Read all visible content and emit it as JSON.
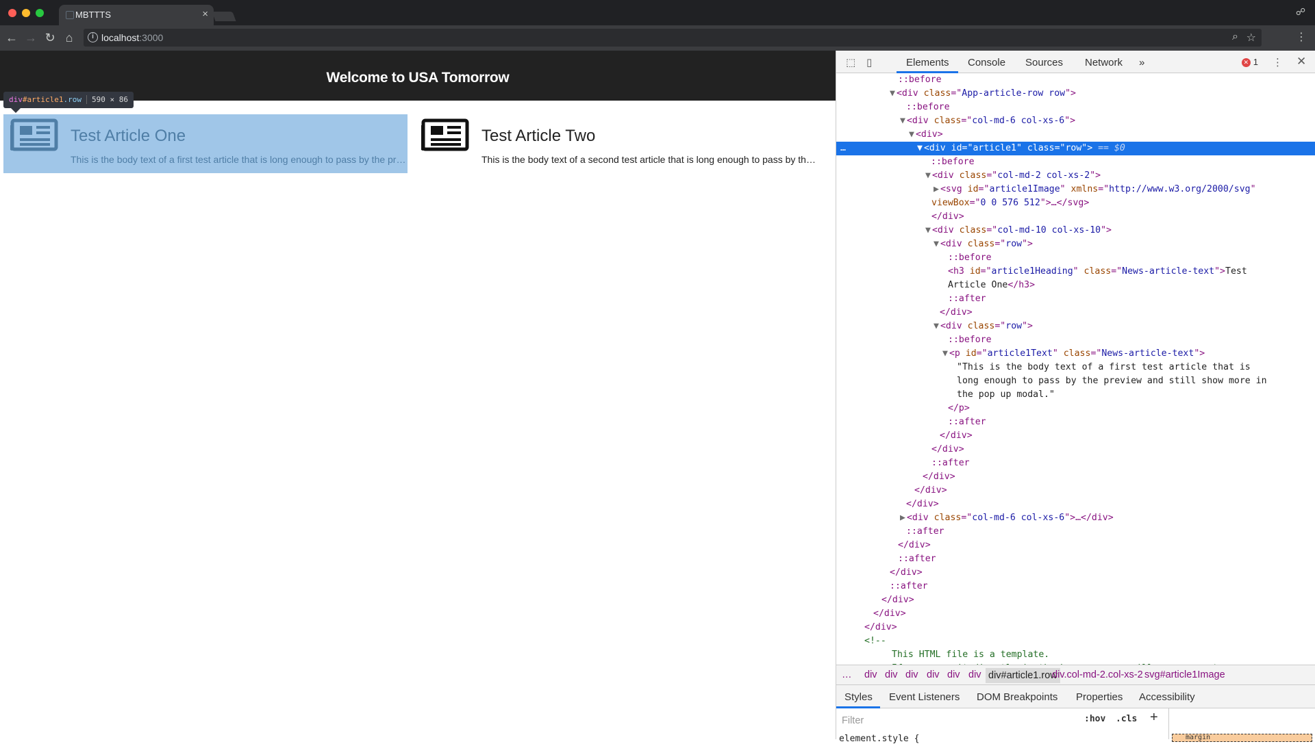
{
  "browser": {
    "tab_title": "MBTTTS",
    "url_host": "localhost",
    "url_port": ":3000",
    "traffic_colors": [
      "#fe5f57",
      "#febc2e",
      "#28c840"
    ]
  },
  "page": {
    "title": "Welcome to USA Tomorrow",
    "articles": [
      {
        "heading": "Test Article One",
        "text": "This is the body text of a first test article that is long enough to pass by the preview and still show more in the pop up modal."
      },
      {
        "heading": "Test Article Two",
        "text": "This is the body text of a second test article that is long enough to pass by the preview and still show more in the pop up modal."
      }
    ],
    "inspect_tooltip": {
      "tag": "div",
      "id": "#article1",
      "cls": ".row",
      "dims": "590 × 86"
    }
  },
  "devtools": {
    "tabs": [
      "Elements",
      "Console",
      "Sources",
      "Network",
      "»"
    ],
    "error_count": "1",
    "dom_lines": [
      [
        {
          "c": "p",
          "t": "::before"
        }
      ],
      [
        {
          "c": "caret",
          "t": "▼"
        },
        {
          "c": "t",
          "t": "<div "
        },
        {
          "c": "a",
          "t": "class"
        },
        {
          "c": "t",
          "t": "=\""
        },
        {
          "c": "v",
          "t": "App-article-row row"
        },
        {
          "c": "t",
          "t": "\">"
        }
      ],
      [
        {
          "c": "p",
          "t": "::before"
        }
      ],
      [
        {
          "c": "caret",
          "t": "▼"
        },
        {
          "c": "t",
          "t": "<div "
        },
        {
          "c": "a",
          "t": "class"
        },
        {
          "c": "t",
          "t": "=\""
        },
        {
          "c": "v",
          "t": "col-md-6 col-xs-6"
        },
        {
          "c": "t",
          "t": "\">"
        }
      ],
      [
        {
          "c": "caret",
          "t": "▼"
        },
        {
          "c": "t",
          "t": "<div>"
        }
      ],
      [
        {
          "c": "caret",
          "t": "▼"
        },
        {
          "c": "t",
          "t": "<div "
        },
        {
          "c": "a",
          "t": "id"
        },
        {
          "c": "t",
          "t": "=\""
        },
        {
          "c": "v",
          "t": "article1"
        },
        {
          "c": "t",
          "t": "\" "
        },
        {
          "c": "a",
          "t": "class"
        },
        {
          "c": "t",
          "t": "=\""
        },
        {
          "c": "v",
          "t": "row"
        },
        {
          "c": "t",
          "t": "\">"
        },
        {
          "c": "eq0",
          "t": " == $0"
        }
      ],
      [
        {
          "c": "p",
          "t": "::before"
        }
      ],
      [
        {
          "c": "caret",
          "t": "▼"
        },
        {
          "c": "t",
          "t": "<div "
        },
        {
          "c": "a",
          "t": "class"
        },
        {
          "c": "t",
          "t": "=\""
        },
        {
          "c": "v",
          "t": "col-md-2 col-xs-2"
        },
        {
          "c": "t",
          "t": "\">"
        }
      ],
      [
        {
          "c": "caret",
          "t": "▶"
        },
        {
          "c": "t",
          "t": "<svg "
        },
        {
          "c": "a",
          "t": "id"
        },
        {
          "c": "t",
          "t": "=\""
        },
        {
          "c": "v",
          "t": "article1Image"
        },
        {
          "c": "t",
          "t": "\" "
        },
        {
          "c": "a",
          "t": "xmlns"
        },
        {
          "c": "t",
          "t": "=\""
        },
        {
          "c": "v",
          "t": "http://www.w3.org/2000/svg"
        },
        {
          "c": "t",
          "t": "\""
        }
      ],
      [
        {
          "c": "a",
          "t": "viewBox"
        },
        {
          "c": "t",
          "t": "=\""
        },
        {
          "c": "v",
          "t": "0 0 576 512"
        },
        {
          "c": "t",
          "t": "\">…</svg>"
        }
      ],
      [
        {
          "c": "t",
          "t": "</div>"
        }
      ],
      [
        {
          "c": "caret",
          "t": "▼"
        },
        {
          "c": "t",
          "t": "<div "
        },
        {
          "c": "a",
          "t": "class"
        },
        {
          "c": "t",
          "t": "=\""
        },
        {
          "c": "v",
          "t": "col-md-10 col-xs-10"
        },
        {
          "c": "t",
          "t": "\">"
        }
      ],
      [
        {
          "c": "caret",
          "t": "▼"
        },
        {
          "c": "t",
          "t": "<div "
        },
        {
          "c": "a",
          "t": "class"
        },
        {
          "c": "t",
          "t": "=\""
        },
        {
          "c": "v",
          "t": "row"
        },
        {
          "c": "t",
          "t": "\">"
        }
      ],
      [
        {
          "c": "p",
          "t": "::before"
        }
      ],
      [
        {
          "c": "t",
          "t": "<h3 "
        },
        {
          "c": "a",
          "t": "id"
        },
        {
          "c": "t",
          "t": "=\""
        },
        {
          "c": "v",
          "t": "article1Heading"
        },
        {
          "c": "t",
          "t": "\" "
        },
        {
          "c": "a",
          "t": "class"
        },
        {
          "c": "t",
          "t": "=\""
        },
        {
          "c": "v",
          "t": "News-article-text"
        },
        {
          "c": "t",
          "t": "\">"
        },
        {
          "c": "s",
          "t": "Test"
        }
      ],
      [
        {
          "c": "s",
          "t": "Article One"
        },
        {
          "c": "t",
          "t": "</h3>"
        }
      ],
      [
        {
          "c": "p",
          "t": "::after"
        }
      ],
      [
        {
          "c": "t",
          "t": "</div>"
        }
      ],
      [
        {
          "c": "caret",
          "t": "▼"
        },
        {
          "c": "t",
          "t": "<div "
        },
        {
          "c": "a",
          "t": "class"
        },
        {
          "c": "t",
          "t": "=\""
        },
        {
          "c": "v",
          "t": "row"
        },
        {
          "c": "t",
          "t": "\">"
        }
      ],
      [
        {
          "c": "p",
          "t": "::before"
        }
      ],
      [
        {
          "c": "caret",
          "t": "▼"
        },
        {
          "c": "t",
          "t": "<p "
        },
        {
          "c": "a",
          "t": "id"
        },
        {
          "c": "t",
          "t": "=\""
        },
        {
          "c": "v",
          "t": "article1Text"
        },
        {
          "c": "t",
          "t": "\" "
        },
        {
          "c": "a",
          "t": "class"
        },
        {
          "c": "t",
          "t": "=\""
        },
        {
          "c": "v",
          "t": "News-article-text"
        },
        {
          "c": "t",
          "t": "\">"
        }
      ],
      [
        {
          "c": "s",
          "t": "\"This is the body text of a first test article that is"
        }
      ],
      [
        {
          "c": "s",
          "t": "long enough to pass by the preview and still show more in"
        }
      ],
      [
        {
          "c": "s",
          "t": "the pop up modal.\""
        }
      ],
      [
        {
          "c": "t",
          "t": "</p>"
        }
      ],
      [
        {
          "c": "p",
          "t": "::after"
        }
      ],
      [
        {
          "c": "t",
          "t": "</div>"
        }
      ],
      [
        {
          "c": "t",
          "t": "</div>"
        }
      ],
      [
        {
          "c": "p",
          "t": "::after"
        }
      ],
      [
        {
          "c": "t",
          "t": "</div>"
        }
      ],
      [
        {
          "c": "t",
          "t": "</div>"
        }
      ],
      [
        {
          "c": "t",
          "t": "</div>"
        }
      ],
      [
        {
          "c": "caret",
          "t": "▶"
        },
        {
          "c": "t",
          "t": "<div "
        },
        {
          "c": "a",
          "t": "class"
        },
        {
          "c": "t",
          "t": "=\""
        },
        {
          "c": "v",
          "t": "col-md-6 col-xs-6"
        },
        {
          "c": "t",
          "t": "\">…</div>"
        }
      ],
      [
        {
          "c": "p",
          "t": "::after"
        }
      ],
      [
        {
          "c": "t",
          "t": "</div>"
        }
      ],
      [
        {
          "c": "p",
          "t": "::after"
        }
      ],
      [
        {
          "c": "t",
          "t": "</div>"
        }
      ],
      [
        {
          "c": "p",
          "t": "::after"
        }
      ],
      [
        {
          "c": "t",
          "t": "</div>"
        }
      ],
      [
        {
          "c": "t",
          "t": "</div>"
        }
      ],
      [
        {
          "c": "t",
          "t": "</div>"
        }
      ],
      [
        {
          "c": "cm",
          "t": "<!--"
        }
      ],
      [
        {
          "c": "cm",
          "t": "This HTML file is a template."
        }
      ],
      [
        {
          "c": "cm",
          "t": "If you open it directly in the browser, you will see an empty page."
        }
      ]
    ],
    "breadcrumbs": [
      "…",
      "div",
      "div",
      "div",
      "div",
      "div",
      "div",
      "div#article1.row",
      "div.col-md-2.col-xs-2",
      "svg#article1Image"
    ],
    "styles_tabs": [
      "Styles",
      "Event Listeners",
      "DOM Breakpoints",
      "Properties",
      "Accessibility"
    ],
    "filter_placeholder": "Filter",
    "hov_label": ":hov",
    "cls_label": ".cls",
    "element_style": "element.style {",
    "box_model_label": "margin"
  }
}
